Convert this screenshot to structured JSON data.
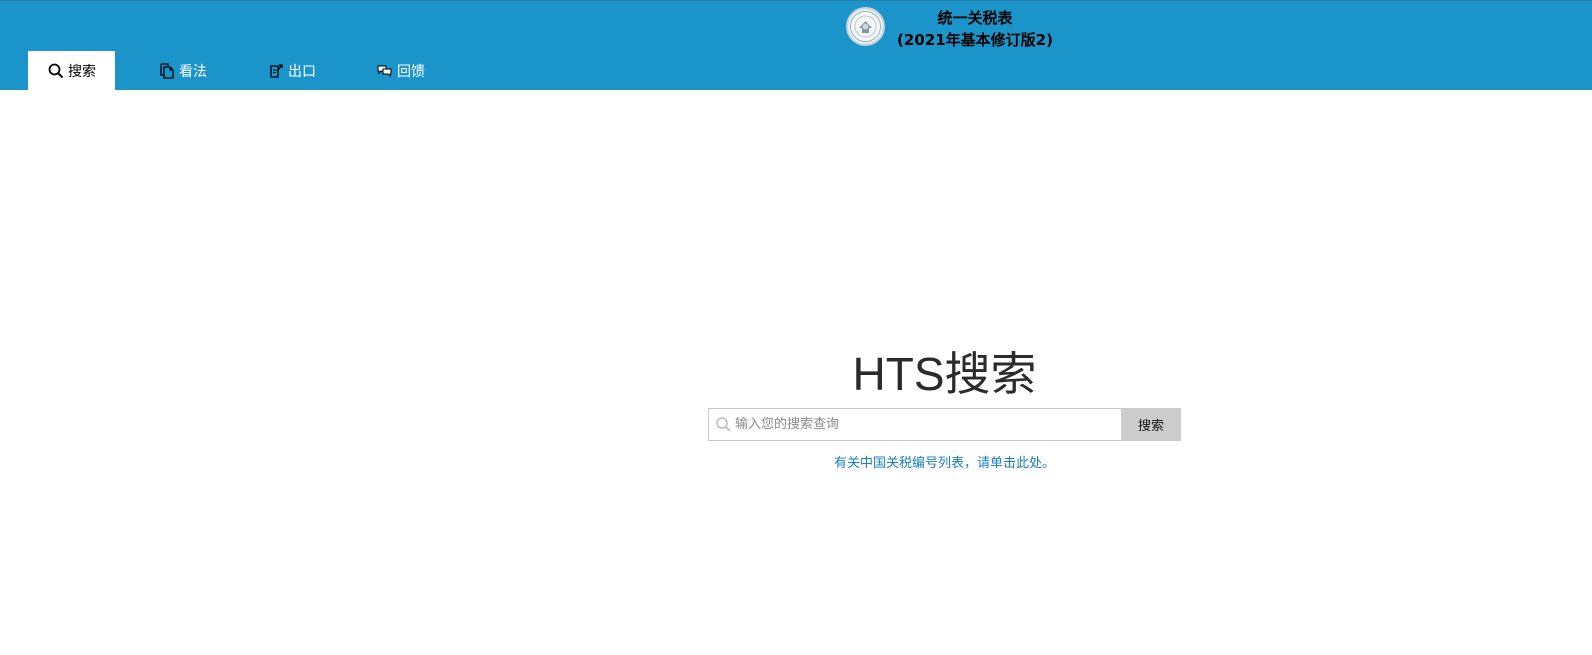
{
  "header": {
    "title_line1": "统一关税表",
    "title_line2": "(2021年基本修订版2)",
    "seal_icon": "usitc-seal-icon",
    "background": "#1b95c9"
  },
  "nav": {
    "items": [
      {
        "label": "搜索",
        "icon": "search-icon",
        "active": true
      },
      {
        "label": "看法",
        "icon": "documents-icon",
        "active": false
      },
      {
        "label": "出口",
        "icon": "export-icon",
        "active": false
      },
      {
        "label": "回馈",
        "icon": "feedback-icon",
        "active": false
      }
    ]
  },
  "main": {
    "title": "HTS搜索",
    "search": {
      "placeholder": "输入您的搜索查询",
      "value": "",
      "button_label": "搜索"
    },
    "china_link": "有关中国关税编号列表，请单击此处。",
    "link_color": "#1b7fbf"
  }
}
